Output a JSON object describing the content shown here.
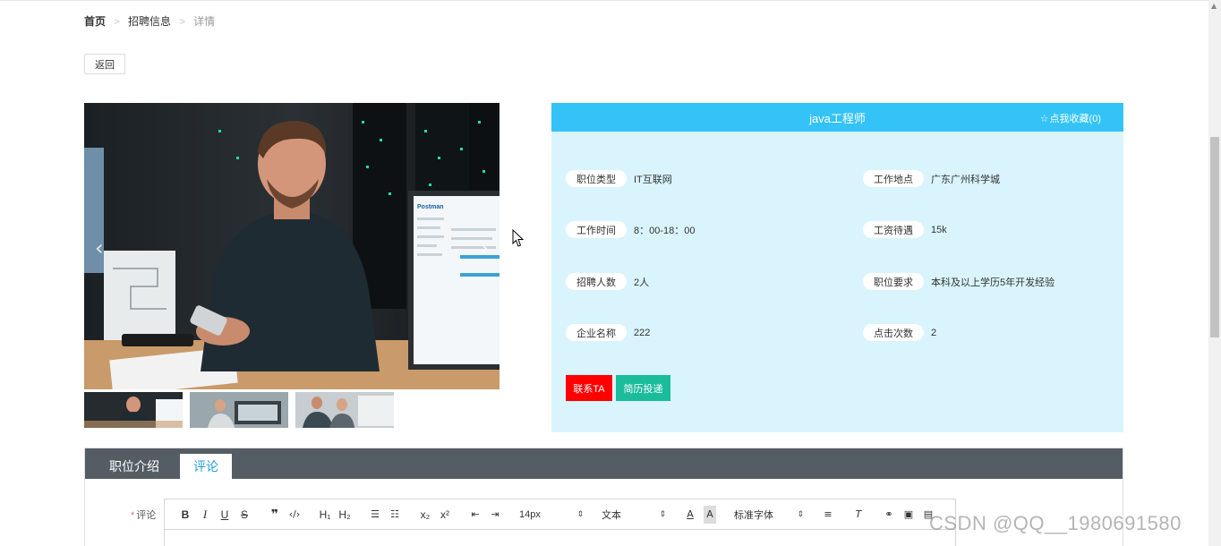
{
  "breadcrumb": {
    "home": "首页",
    "section": "招聘信息",
    "current": "详情",
    "separator": ">"
  },
  "back_button": "返回",
  "carousel": {
    "prev_icon": "chevron-left-icon",
    "next_icon": "chevron-right-icon",
    "screen_brand": "Postman"
  },
  "job": {
    "title": "java工程师",
    "favorite_label": "点我收藏(0)",
    "fields": [
      {
        "label": "职位类型",
        "value": "IT互联网"
      },
      {
        "label": "工作地点",
        "value": "广东广州科学城"
      },
      {
        "label": "工作时间",
        "value": "8：00-18：00"
      },
      {
        "label": "工资待遇",
        "value": "15k"
      },
      {
        "label": "招聘人数",
        "value": "2人"
      },
      {
        "label": "职位要求",
        "value": "本科及以上学历5年开发经验"
      },
      {
        "label": "企业名称",
        "value": "222"
      },
      {
        "label": "点击次数",
        "value": "2"
      }
    ],
    "contact_button": "联系TA",
    "resume_button": "简历投递"
  },
  "tabs": [
    {
      "label": "职位介绍",
      "active": false
    },
    {
      "label": "评论",
      "active": true
    }
  ],
  "comment": {
    "required_mark": "*",
    "label": "评论"
  },
  "editor_toolbar": {
    "bold": "B",
    "italic": "I",
    "underline": "U",
    "strike": "S",
    "h1": "H₁",
    "h2": "H₂",
    "sub": "x₂",
    "sup": "x²",
    "size": "14px",
    "format": "文本",
    "font": "标准字体"
  },
  "watermark": "CSDN @QQ__1980691580",
  "colors": {
    "header_blue": "#33c3f7",
    "panel_bg": "#d9f4fd",
    "contact_red": "#ff0000",
    "resume_green": "#1abc9c",
    "tab_bar": "#555d64",
    "tab_active_text": "#1f9ed8"
  }
}
